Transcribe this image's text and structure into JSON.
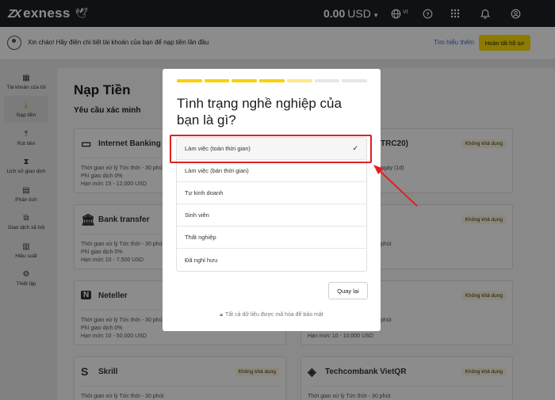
{
  "header": {
    "brand": "exness",
    "balance": "0.00",
    "currency": "USD",
    "language": "VI"
  },
  "banner": {
    "message": "Xin chào! Hãy điền chi tiết tài khoản của bạn để nạp tiền lần đầu",
    "learn_more": "Tìm hiểu thêm",
    "finish_button": "Hoàn tất hồ sơ"
  },
  "sidebar": {
    "items": [
      {
        "label": "Tài khoản của tôi",
        "icon": "grid-icon"
      },
      {
        "label": "Nạp tiền",
        "icon": "deposit-icon"
      },
      {
        "label": "Rút tiền",
        "icon": "withdraw-icon"
      },
      {
        "label": "Lịch sử giao dịch",
        "icon": "hourglass-icon"
      },
      {
        "label": "Phân tích",
        "icon": "analytics-icon"
      },
      {
        "label": "Giao dịch xã hội",
        "icon": "social-icon"
      },
      {
        "label": "Hiệu suất",
        "icon": "performance-icon"
      },
      {
        "label": "Thiết lập",
        "icon": "gear-icon"
      }
    ]
  },
  "main": {
    "title": "Nạp Tiền",
    "subtitle": "Yêu cầu xác minh",
    "cards": [
      {
        "name": "Internet Banking",
        "line1": "Thời gian xử lý  Tức thời - 30 phút",
        "line2": "Phí giao dịch  0%",
        "line3": "Hạn mức  15 - 12,000 USD"
      },
      {
        "name": "TRC20)",
        "badge": "Không khả dụng",
        "line1": "ngày (1d)",
        "line2": "",
        "line3": ""
      },
      {
        "name": "Bank transfer",
        "line1": "Thời gian xử lý  Tức thời - 30 phút",
        "line2": "Phí giao dịch  0%",
        "line3": "Hạn mức  10 - 7,500 USD"
      },
      {
        "name": "",
        "badge": "Không khả dụng",
        "line1": "phút",
        "line2": "",
        "line3": ""
      },
      {
        "name": "Neteller",
        "line1": "Thời gian xử lý  Tức thời - 30 phút",
        "line2": "Phí giao dịch  0%",
        "line3": "Hạn mức  10 - 50,000 USD"
      },
      {
        "name": "",
        "badge": "Không khả dụng",
        "line1": "phút",
        "line2": "",
        "line3": "Hạn mức  10 - 10,000 USD"
      },
      {
        "name": "Skrill",
        "badge": "Không khả dụng",
        "line1": "Thời gian xử lý  Tức thời - 30 phút",
        "line2": "",
        "line3": ""
      },
      {
        "name": "Techcombank VietQR",
        "badge": "Không khả dụng",
        "line1": "Thời gian xử lý  Tức thời - 30 phút",
        "line2": "",
        "line3": ""
      }
    ]
  },
  "modal": {
    "question": "Tình trạng nghề nghiệp của bạn là gì?",
    "options": [
      "Làm việc (toàn thời gian)",
      "Làm việc (bán thời gian)",
      "Tự kinh doanh",
      "Sinh viên",
      "Thất nghiệp",
      "Đã nghỉ hưu"
    ],
    "selected_index": 0,
    "back_button": "Quay lại",
    "secure_note": "Tất cả dữ liệu được mã hóa để bảo mật",
    "progress_steps": 7,
    "progress_completed": 4
  },
  "colors": {
    "accent": "#ffde02",
    "topbar": "#1d2125",
    "annotation": "#e02020"
  }
}
